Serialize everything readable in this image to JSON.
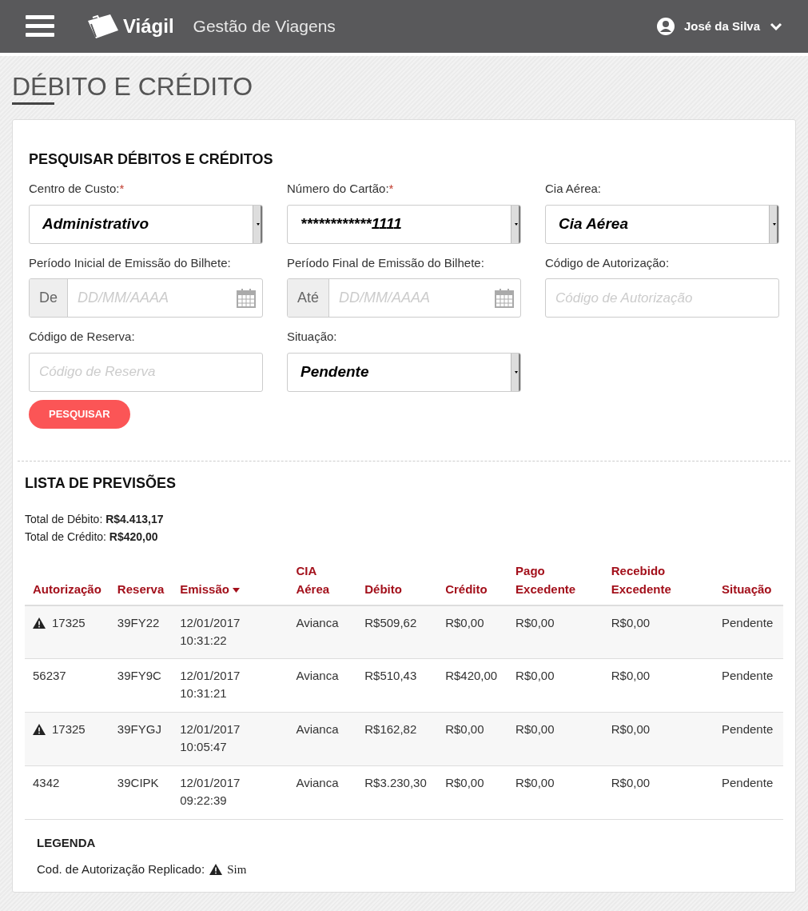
{
  "header": {
    "brand": "Viágil",
    "subtitle": "Gestão de Viagens",
    "user": "José da Silva"
  },
  "page_title": "DÉBITO E CRÉDITO",
  "search": {
    "title": "PESQUISAR DÉBITOS E CRÉDITOS",
    "fields": [
      {
        "kind": "select",
        "label": "Centro de Custo:",
        "required_mark": "*",
        "value": "Administrativo"
      },
      {
        "kind": "select",
        "label": "Número do Cartão:",
        "required_mark": "*",
        "value": "************1111"
      },
      {
        "kind": "select",
        "label": "Cia Aérea:",
        "value": "Cia Aérea"
      },
      {
        "kind": "date",
        "label": "Período Inicial de Emissão do Bilhete:",
        "addon": "De",
        "placeholder": "DD/MM/AAAA"
      },
      {
        "kind": "date",
        "label": "Período Final de Emissão do Bilhete:",
        "addon": "Até",
        "placeholder": "DD/MM/AAAA"
      },
      {
        "kind": "text",
        "label": "Código de Autorização:",
        "placeholder": "Código de Autorização"
      },
      {
        "kind": "text",
        "label": "Código de Reserva:",
        "placeholder": "Código de Reserva"
      },
      {
        "kind": "select",
        "label": "Situação:",
        "value": "Pendente"
      }
    ],
    "button": "PESQUISAR"
  },
  "list": {
    "title": "LISTA DE PREVISÕES",
    "totals": [
      {
        "label": "Total de Débito:",
        "value": "R$4.413,17"
      },
      {
        "label": "Total de Crédito:",
        "value": "R$420,00"
      }
    ],
    "columns": [
      {
        "lines": [
          "Autorização"
        ],
        "sorted": false
      },
      {
        "lines": [
          "Reserva"
        ],
        "sorted": false
      },
      {
        "lines": [
          "Emissão"
        ],
        "sorted": true
      },
      {
        "lines": [
          "CIA",
          "Aérea"
        ],
        "sorted": false
      },
      {
        "lines": [
          "Débito"
        ],
        "sorted": false
      },
      {
        "lines": [
          "Crédito"
        ],
        "sorted": false
      },
      {
        "lines": [
          "Pago",
          "Excedente"
        ],
        "sorted": false
      },
      {
        "lines": [
          "Recebido",
          "Excedente"
        ],
        "sorted": false
      },
      {
        "lines": [
          "Situação"
        ],
        "sorted": false
      }
    ],
    "rows": [
      {
        "replicated": true,
        "cells": [
          "17325",
          "39FY22",
          [
            "12/01/2017",
            "10:31:22"
          ],
          "Avianca",
          "R$509,62",
          "R$0,00",
          "R$0,00",
          "R$0,00",
          "Pendente"
        ]
      },
      {
        "replicated": false,
        "cells": [
          "56237",
          "39FY9C",
          [
            "12/01/2017",
            "10:31:21"
          ],
          "Avianca",
          "R$510,43",
          "R$420,00",
          "R$0,00",
          "R$0,00",
          "Pendente"
        ]
      },
      {
        "replicated": true,
        "cells": [
          "17325",
          "39FYGJ",
          [
            "12/01/2017",
            "10:05:47"
          ],
          "Avianca",
          "R$162,82",
          "R$0,00",
          "R$0,00",
          "R$0,00",
          "Pendente"
        ]
      },
      {
        "replicated": false,
        "cells": [
          "4342",
          "39CIPK",
          [
            "12/01/2017",
            "09:22:39"
          ],
          "Avianca",
          "R$3.230,30",
          "R$0,00",
          "R$0,00",
          "R$0,00",
          "Pendente"
        ]
      }
    ],
    "legend": {
      "title": "LEGENDA",
      "label": "Cod. de Autorização Replicado:",
      "value": "Sim"
    }
  }
}
